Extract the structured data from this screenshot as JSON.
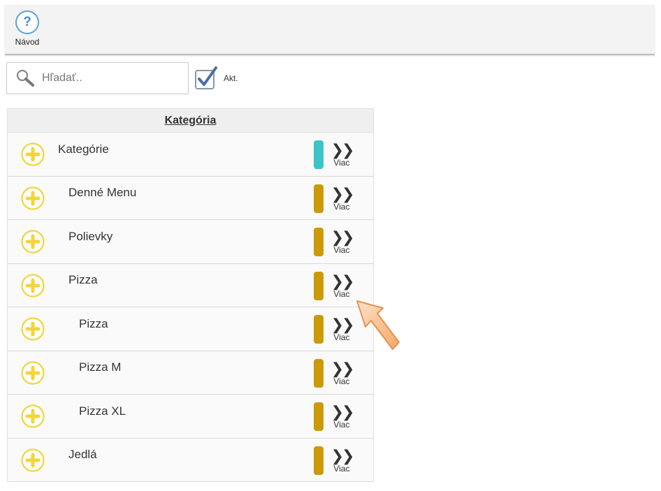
{
  "toolbar": {
    "help_label": "Návod",
    "help_glyph": "?"
  },
  "search": {
    "placeholder": "Hľadať..",
    "value": ""
  },
  "filter": {
    "active_label": "Akt.",
    "active_checked": true
  },
  "table": {
    "header": "Kategória",
    "more_label": "Viac",
    "more_glyph": "❯❯",
    "rows": [
      {
        "label": "Kategórie",
        "indent": 0,
        "color": "#3cc4c8"
      },
      {
        "label": "Denné Menu",
        "indent": 1,
        "color": "#cc9a06"
      },
      {
        "label": "Polievky",
        "indent": 1,
        "color": "#cc9a06"
      },
      {
        "label": "Pizza",
        "indent": 1,
        "color": "#cc9a06"
      },
      {
        "label": "Pizza",
        "indent": 2,
        "color": "#cc9a06"
      },
      {
        "label": "Pizza M",
        "indent": 2,
        "color": "#cc9a06"
      },
      {
        "label": "Pizza XL",
        "indent": 2,
        "color": "#cc9a06"
      },
      {
        "label": "Jedlá",
        "indent": 1,
        "color": "#cc9a06"
      }
    ]
  },
  "colors": {
    "accent_blue": "#5ba3d6",
    "plus_yellow": "#f2d53a",
    "cursor_orange": "#f6b27a"
  }
}
